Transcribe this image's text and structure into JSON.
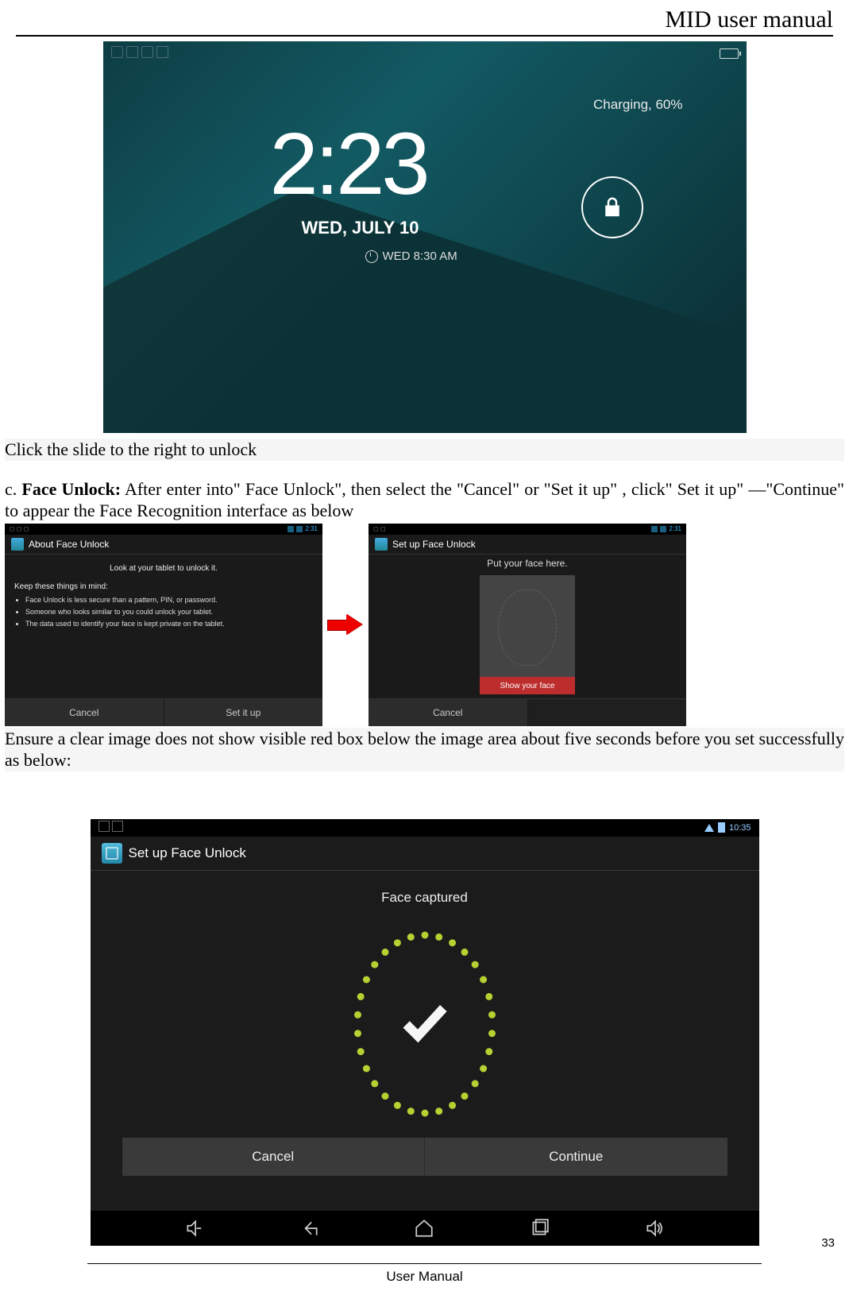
{
  "doc": {
    "header_title": "MID user manual",
    "footer": "User Manual",
    "page_number": "33"
  },
  "text": {
    "slide_unlock": "Click the slide to the right to unlock",
    "face_unlock_para": "c. Face Unlock: After enter into\" Face Unlock\", then select the \"Cancel\" or \"Set it up\" , click\" Set it up\" —\"Continue\" to appear the Face Recognition interface as below",
    "face_unlock_label": "Face Unlock:",
    "ensure_para": "Ensure a clear image does not show visible red box below the image area about five seconds before you set successfully as below:"
  },
  "lockscreen": {
    "charging": "Charging, 60%",
    "time": "2:23",
    "date": "WED, JULY 10",
    "alarm": "WED 8:30 AM"
  },
  "about_face_unlock": {
    "title": "About Face Unlock",
    "headline": "Look at your tablet to unlock it.",
    "keep": "Keep these things in mind:",
    "bullets": [
      "Face Unlock is less secure than a pattern, PIN, or password.",
      "Someone who looks similar to you could unlock your tablet.",
      "The data used to identify your face is kept private on the tablet."
    ],
    "btn_cancel": "Cancel",
    "btn_setup": "Set it up",
    "status_time": "2:31"
  },
  "setup_face": {
    "title": "Set up Face Unlock",
    "prompt": "Put your face here.",
    "show_face": "Show your face",
    "btn_cancel": "Cancel",
    "status_time": "2:31"
  },
  "captured": {
    "title": "Set up Face Unlock",
    "status": "Face captured",
    "btn_cancel": "Cancel",
    "btn_continue": "Continue",
    "status_time": "10:35"
  }
}
